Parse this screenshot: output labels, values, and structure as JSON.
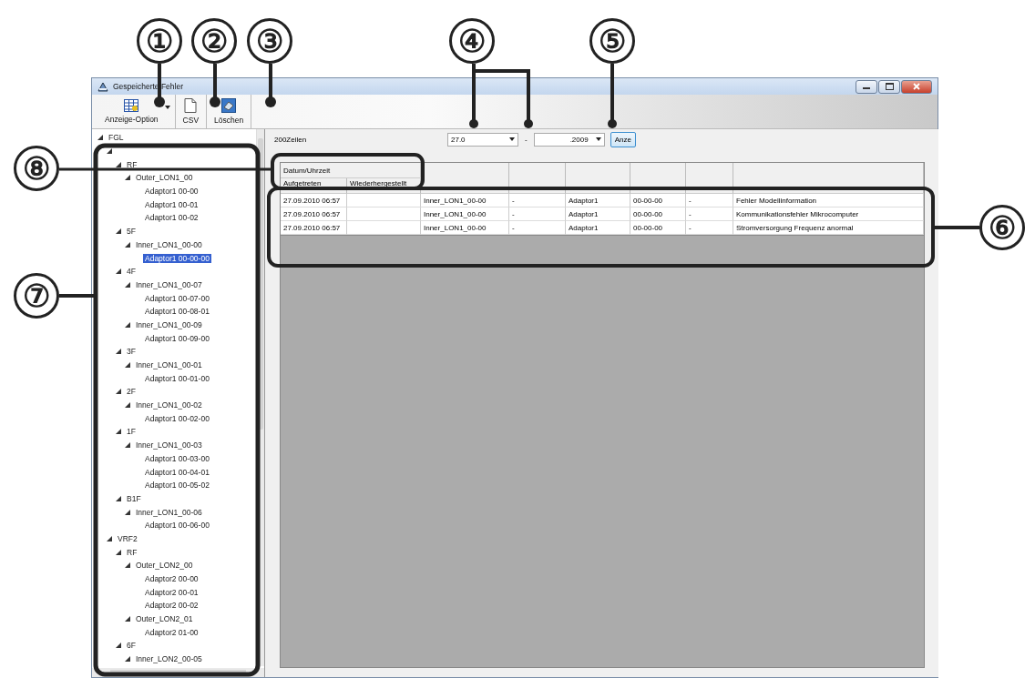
{
  "window": {
    "title": "Gespeicherte Fehler"
  },
  "toolbar": [
    {
      "label": "Anzeige-Option",
      "kind": "grid",
      "has_dropdown": true
    },
    {
      "label": "CSV",
      "kind": "document",
      "has_dropdown": false
    },
    {
      "label": "Löschen",
      "kind": "erase",
      "has_dropdown": false
    }
  ],
  "tree": [
    {
      "label": "FGL",
      "expanded": true,
      "selected": false,
      "children": [
        {
          "expanded": true,
          "selected": false,
          "children": [
            {
              "label": "RF",
              "expanded": true,
              "selected": false,
              "children": [
                {
                  "label": "Outer_LON1_00",
                  "expanded": true,
                  "selected": false,
                  "children": [
                    {
                      "label": "Adaptor1 00-00",
                      "selected": false
                    },
                    {
                      "label": "Adaptor1 00-01",
                      "selected": false
                    },
                    {
                      "label": "Adaptor1 00-02",
                      "selected": false
                    }
                  ]
                }
              ]
            },
            {
              "label": "5F",
              "expanded": true,
              "selected": false,
              "children": [
                {
                  "label": "Inner_LON1_00-00",
                  "expanded": true,
                  "selected": false,
                  "children": [
                    {
                      "label": "Adaptor1 00-00-00",
                      "selected": true
                    }
                  ]
                }
              ]
            },
            {
              "label": "4F",
              "expanded": true,
              "selected": false,
              "children": [
                {
                  "label": "Inner_LON1_00-07",
                  "expanded": true,
                  "selected": false,
                  "children": [
                    {
                      "label": "Adaptor1 00-07-00",
                      "selected": false
                    },
                    {
                      "label": "Adaptor1 00-08-01",
                      "selected": false
                    }
                  ]
                },
                {
                  "label": "Inner_LON1_00-09",
                  "expanded": true,
                  "selected": false,
                  "children": [
                    {
                      "label": "Adaptor1 00-09-00",
                      "selected": false
                    }
                  ]
                }
              ]
            },
            {
              "label": "3F",
              "expanded": true,
              "selected": false,
              "children": [
                {
                  "label": "Inner_LON1_00-01",
                  "expanded": true,
                  "selected": false,
                  "children": [
                    {
                      "label": "Adaptor1 00-01-00",
                      "selected": false
                    }
                  ]
                }
              ]
            },
            {
              "label": "2F",
              "expanded": true,
              "selected": false,
              "children": [
                {
                  "label": "Inner_LON1_00-02",
                  "expanded": true,
                  "selected": false,
                  "children": [
                    {
                      "label": "Adaptor1 00-02-00",
                      "selected": false
                    }
                  ]
                }
              ]
            },
            {
              "label": "1F",
              "expanded": true,
              "selected": false,
              "children": [
                {
                  "label": "Inner_LON1_00-03",
                  "expanded": true,
                  "selected": false,
                  "children": [
                    {
                      "label": "Adaptor1 00-03-00",
                      "selected": false
                    },
                    {
                      "label": "Adaptor1 00-04-01",
                      "selected": false
                    },
                    {
                      "label": "Adaptor1 00-05-02",
                      "selected": false
                    }
                  ]
                }
              ]
            },
            {
              "label": "B1F",
              "expanded": true,
              "selected": false,
              "children": [
                {
                  "label": "Inner_LON1_00-06",
                  "expanded": true,
                  "selected": false,
                  "children": [
                    {
                      "label": "Adaptor1 00-06-00",
                      "selected": false
                    }
                  ]
                }
              ]
            }
          ]
        },
        {
          "label": "VRF2",
          "expanded": true,
          "selected": false,
          "children": [
            {
              "label": "RF",
              "expanded": true,
              "selected": false,
              "children": [
                {
                  "label": "Outer_LON2_00",
                  "expanded": true,
                  "selected": false,
                  "children": [
                    {
                      "label": "Adaptor2 00-00",
                      "selected": false
                    },
                    {
                      "label": "Adaptor2 00-01",
                      "selected": false
                    },
                    {
                      "label": "Adaptor2 00-02",
                      "selected": false
                    }
                  ]
                },
                {
                  "label": "Outer_LON2_01",
                  "expanded": true,
                  "selected": false,
                  "children": [
                    {
                      "label": "Adaptor2 01-00",
                      "selected": false
                    }
                  ]
                }
              ]
            },
            {
              "label": "6F",
              "expanded": true,
              "selected": false,
              "children": [
                {
                  "label": "Inner_LON2_00-05",
                  "expanded": true,
                  "selected": false
                }
              ]
            }
          ]
        }
      ]
    }
  ],
  "filter": {
    "row_count": "200Zeilen",
    "date_from": "27.0",
    "separator": "-",
    "date_to": ".2009",
    "button": "Anze"
  },
  "table": {
    "group_header": "Datum/Uhrzeit",
    "subheaders": [
      "Aufgetreten",
      "Wiederhergestellt"
    ],
    "rows": [
      [
        "27.09.2010 06:57",
        "",
        "Inner_LON1_00-00",
        "-",
        "Adaptor1",
        "00-00-00",
        "-",
        "Fehler Modellinformation"
      ],
      [
        "27.09.2010 06:57",
        "",
        "Inner_LON1_00-00",
        "-",
        "Adaptor1",
        "00-00-00",
        "-",
        "Kommunikationsfehler Mikrocomputer"
      ],
      [
        "27.09.2010 06:57",
        "",
        "Inner_LON1_00-00",
        "-",
        "Adaptor1",
        "00-00-00",
        "-",
        "Stromversorgung Frequenz anormal"
      ]
    ]
  },
  "callouts": [
    "①",
    "②",
    "③",
    "④",
    "⑤",
    "⑥",
    "⑦",
    "⑧"
  ]
}
